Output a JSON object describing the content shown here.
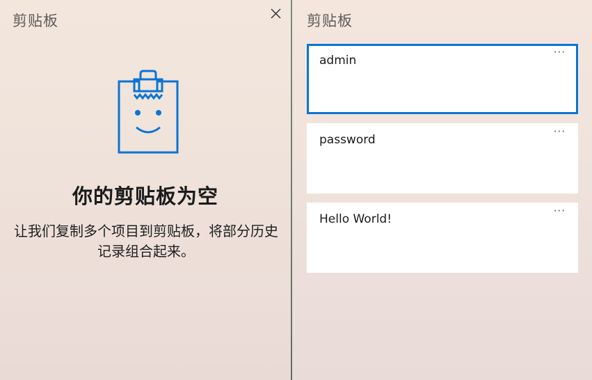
{
  "left_panel": {
    "title": "剪贴板",
    "empty_heading": "你的剪贴板为空",
    "empty_description": "让我们复制多个项目到剪贴板，将部分历史记录组合起来。"
  },
  "right_panel": {
    "title": "剪贴板",
    "items": [
      {
        "text": "admin",
        "more": "···",
        "selected": true
      },
      {
        "text": "password",
        "more": "···",
        "selected": false
      },
      {
        "text": "Hello World!",
        "more": "···",
        "selected": false
      }
    ]
  },
  "icons": {
    "close": "close-icon",
    "illustration": "empty-clipboard-icon",
    "more": "more-options-icon"
  },
  "colors": {
    "accent": "#0A74D4",
    "card_background": "#FFFFFF"
  }
}
